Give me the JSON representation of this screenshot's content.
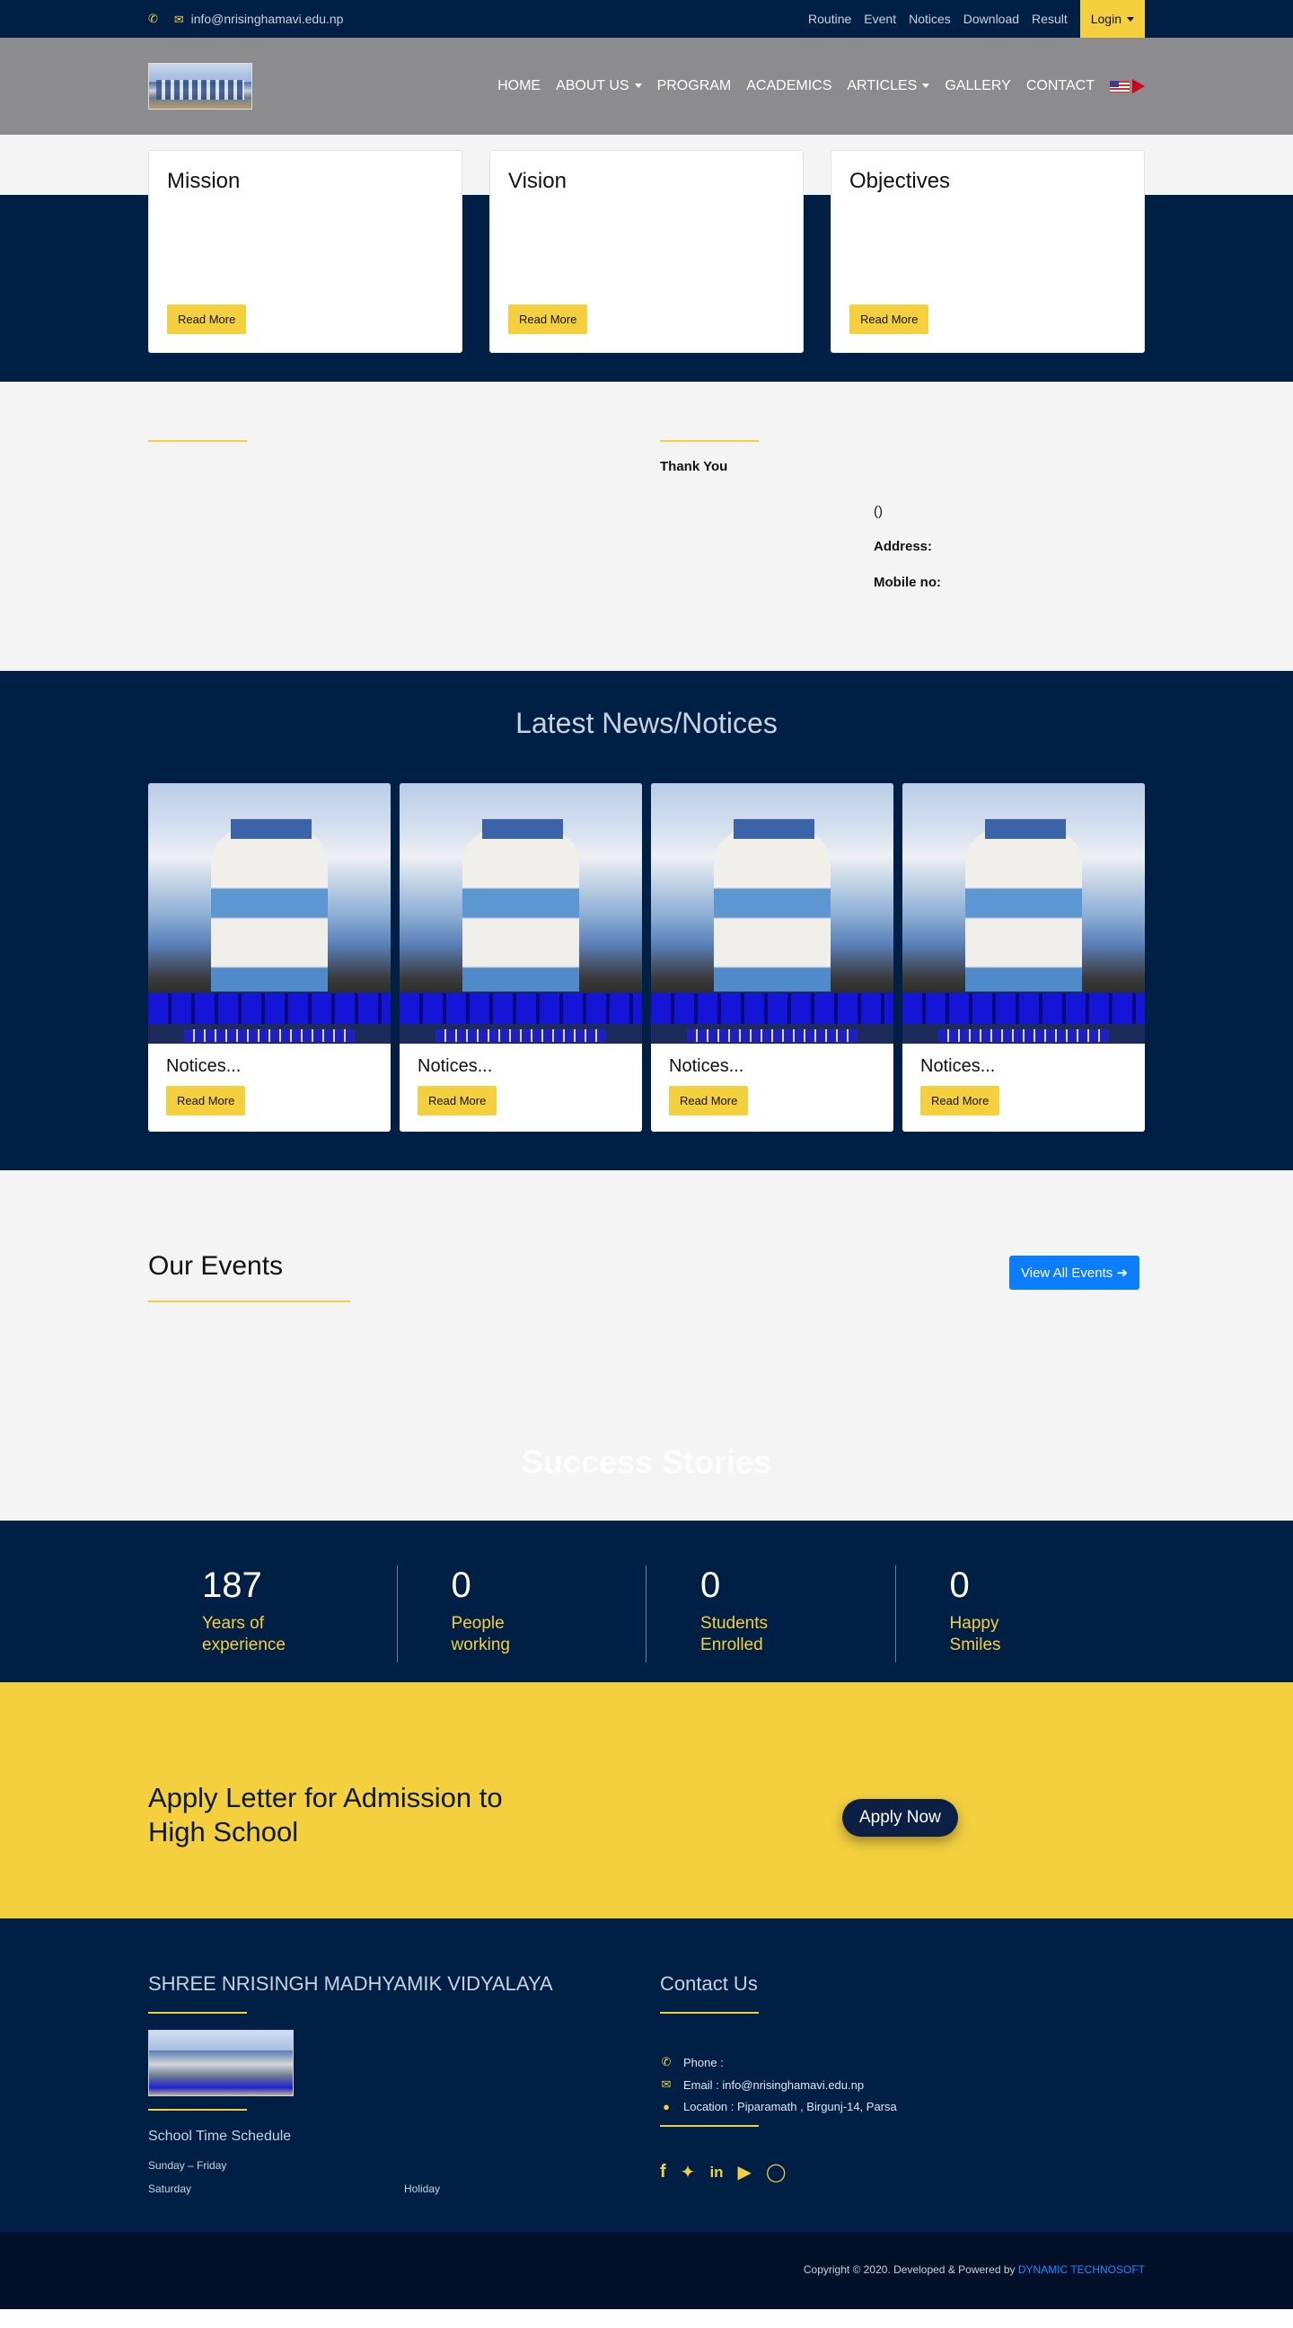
{
  "topbar": {
    "email": "info@nrisinghamavi.edu.np",
    "links": [
      "Routine",
      "Event",
      "Notices",
      "Download",
      "Result"
    ],
    "login_label": "Login"
  },
  "navbar": {
    "menu": [
      "HOME",
      "ABOUT US",
      "PROGRAM",
      "ACADEMICS",
      "ARTICLES",
      "GALLERY",
      "CONTACT"
    ]
  },
  "mission_cards": [
    {
      "title": "Mission",
      "button": "Read More"
    },
    {
      "title": "Vision",
      "button": "Read More"
    },
    {
      "title": "Objectives",
      "button": "Read More"
    }
  ],
  "welcome": {
    "thanks": "Thank You",
    "paren": "()",
    "address_label": "Address:",
    "mobile_label": "Mobile no:"
  },
  "news": {
    "heading": "Latest News/Notices",
    "items": [
      {
        "title": "Notices...",
        "button": "Read More"
      },
      {
        "title": "Notices...",
        "button": "Read More"
      },
      {
        "title": "Notices...",
        "button": "Read More"
      },
      {
        "title": "Notices...",
        "button": "Read More"
      }
    ]
  },
  "events": {
    "heading": "Our Events",
    "view_all": "View All Events",
    "success": "Success Stories"
  },
  "stats": [
    {
      "value": "187",
      "label1": "Years of",
      "label2": "experience"
    },
    {
      "value": "0",
      "label1": "People",
      "label2": "working"
    },
    {
      "value": "0",
      "label1": "Students",
      "label2": "Enrolled"
    },
    {
      "value": "0",
      "label1": "Happy",
      "label2": "Smiles"
    }
  ],
  "apply": {
    "heading": "Apply Letter for Admission to High School",
    "button": "Apply Now"
  },
  "footer": {
    "school_name": "SHREE NRISINGH MADHYAMIK VIDYALAYA",
    "schedule_title": "School Time Schedule",
    "schedule": [
      {
        "day": "Sunday – Friday",
        "time": ""
      },
      {
        "day": "Saturday",
        "time": "Holiday"
      }
    ],
    "contact_title": "Contact Us",
    "phone": "Phone :",
    "email": "Email : info@nrisinghamavi.edu.np",
    "location": "Location : Piparamath , Birgunj-14, Parsa",
    "copyright": "Copyright © 2020. Developed & Powered by",
    "company": "DYNAMIC TECHNOSOFT"
  },
  "colors": {
    "navy": "#001f45",
    "yellow": "#f4d03f",
    "blue": "#0b7dfd"
  }
}
